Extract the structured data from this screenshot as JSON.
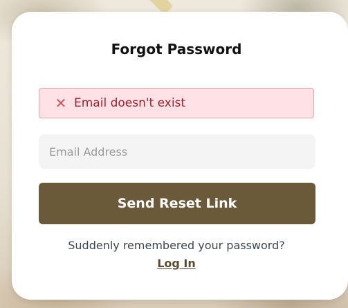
{
  "card": {
    "title": "Forgot Password",
    "error": {
      "icon": "close-icon",
      "message": "Email doesn't exist",
      "bg_color": "#ffe1e6",
      "border_color": "#f0a2ab",
      "text_color": "#9f1f2b",
      "icon_color": "#d24d57"
    },
    "email": {
      "value": "",
      "placeholder": "Email Address"
    },
    "send_button_label": "Send Reset Link",
    "remember_text": "Suddenly remembered your password?",
    "login_link_label": "Log In"
  },
  "colors": {
    "primary_button": "#6b5a3a",
    "card_background": "#ffffff"
  }
}
